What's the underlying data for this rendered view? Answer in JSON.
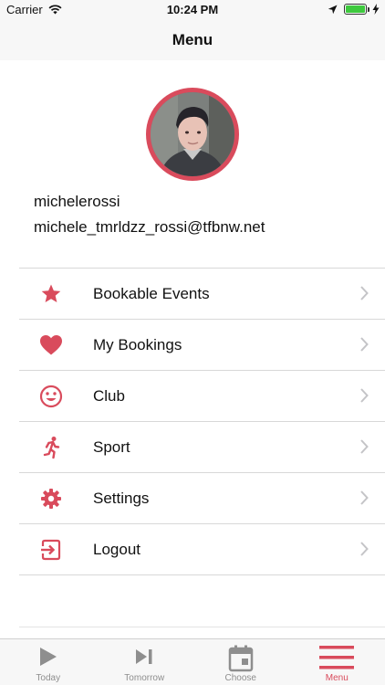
{
  "status_bar": {
    "carrier": "Carrier",
    "time": "10:24 PM",
    "battery_level": 1.0
  },
  "nav": {
    "title": "Menu"
  },
  "profile": {
    "username": "michelerossi",
    "email": "michele_tmrldzz_rossi@tfbnw.net"
  },
  "menu": {
    "items": [
      {
        "label": "Bookable Events",
        "icon": "star-icon"
      },
      {
        "label": "My Bookings",
        "icon": "heart-icon"
      },
      {
        "label": "Club",
        "icon": "smiley-icon"
      },
      {
        "label": "Sport",
        "icon": "running-icon"
      },
      {
        "label": "Settings",
        "icon": "gear-icon"
      },
      {
        "label": "Logout",
        "icon": "logout-icon"
      }
    ]
  },
  "tab_bar": {
    "tabs": [
      {
        "label": "Today",
        "icon": "play-icon"
      },
      {
        "label": "Tomorrow",
        "icon": "skip-forward-icon"
      },
      {
        "label": "Choose",
        "icon": "calendar-icon"
      },
      {
        "label": "Menu",
        "icon": "hamburger-icon",
        "active": true
      }
    ]
  },
  "colors": {
    "accent": "#d94b5c",
    "inactive": "#8e8e8e"
  }
}
